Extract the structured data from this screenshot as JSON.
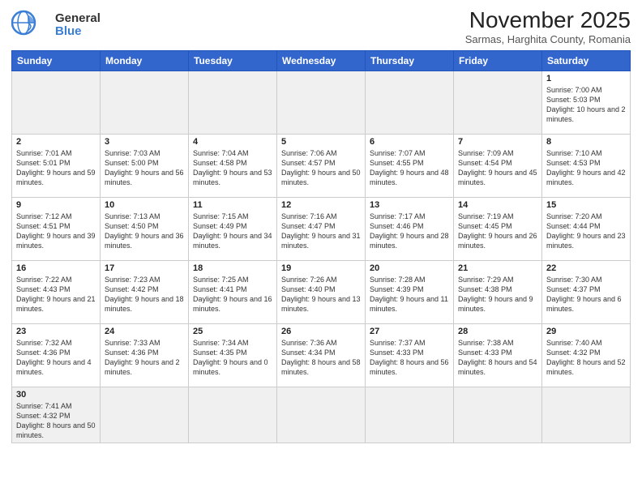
{
  "header": {
    "logo_general": "General",
    "logo_blue": "Blue",
    "month_title": "November 2025",
    "subtitle": "Sarmas, Harghita County, Romania"
  },
  "weekdays": [
    "Sunday",
    "Monday",
    "Tuesday",
    "Wednesday",
    "Thursday",
    "Friday",
    "Saturday"
  ],
  "weeks": [
    [
      {
        "day": "",
        "info": "",
        "empty": true
      },
      {
        "day": "",
        "info": "",
        "empty": true
      },
      {
        "day": "",
        "info": "",
        "empty": true
      },
      {
        "day": "",
        "info": "",
        "empty": true
      },
      {
        "day": "",
        "info": "",
        "empty": true
      },
      {
        "day": "",
        "info": "",
        "empty": true
      },
      {
        "day": "1",
        "info": "Sunrise: 7:00 AM\nSunset: 5:03 PM\nDaylight: 10 hours\nand 2 minutes."
      }
    ],
    [
      {
        "day": "2",
        "info": "Sunrise: 7:01 AM\nSunset: 5:01 PM\nDaylight: 9 hours\nand 59 minutes."
      },
      {
        "day": "3",
        "info": "Sunrise: 7:03 AM\nSunset: 5:00 PM\nDaylight: 9 hours\nand 56 minutes."
      },
      {
        "day": "4",
        "info": "Sunrise: 7:04 AM\nSunset: 4:58 PM\nDaylight: 9 hours\nand 53 minutes."
      },
      {
        "day": "5",
        "info": "Sunrise: 7:06 AM\nSunset: 4:57 PM\nDaylight: 9 hours\nand 50 minutes."
      },
      {
        "day": "6",
        "info": "Sunrise: 7:07 AM\nSunset: 4:55 PM\nDaylight: 9 hours\nand 48 minutes."
      },
      {
        "day": "7",
        "info": "Sunrise: 7:09 AM\nSunset: 4:54 PM\nDaylight: 9 hours\nand 45 minutes."
      },
      {
        "day": "8",
        "info": "Sunrise: 7:10 AM\nSunset: 4:53 PM\nDaylight: 9 hours\nand 42 minutes."
      }
    ],
    [
      {
        "day": "9",
        "info": "Sunrise: 7:12 AM\nSunset: 4:51 PM\nDaylight: 9 hours\nand 39 minutes."
      },
      {
        "day": "10",
        "info": "Sunrise: 7:13 AM\nSunset: 4:50 PM\nDaylight: 9 hours\nand 36 minutes."
      },
      {
        "day": "11",
        "info": "Sunrise: 7:15 AM\nSunset: 4:49 PM\nDaylight: 9 hours\nand 34 minutes."
      },
      {
        "day": "12",
        "info": "Sunrise: 7:16 AM\nSunset: 4:47 PM\nDaylight: 9 hours\nand 31 minutes."
      },
      {
        "day": "13",
        "info": "Sunrise: 7:17 AM\nSunset: 4:46 PM\nDaylight: 9 hours\nand 28 minutes."
      },
      {
        "day": "14",
        "info": "Sunrise: 7:19 AM\nSunset: 4:45 PM\nDaylight: 9 hours\nand 26 minutes."
      },
      {
        "day": "15",
        "info": "Sunrise: 7:20 AM\nSunset: 4:44 PM\nDaylight: 9 hours\nand 23 minutes."
      }
    ],
    [
      {
        "day": "16",
        "info": "Sunrise: 7:22 AM\nSunset: 4:43 PM\nDaylight: 9 hours\nand 21 minutes."
      },
      {
        "day": "17",
        "info": "Sunrise: 7:23 AM\nSunset: 4:42 PM\nDaylight: 9 hours\nand 18 minutes."
      },
      {
        "day": "18",
        "info": "Sunrise: 7:25 AM\nSunset: 4:41 PM\nDaylight: 9 hours\nand 16 minutes."
      },
      {
        "day": "19",
        "info": "Sunrise: 7:26 AM\nSunset: 4:40 PM\nDaylight: 9 hours\nand 13 minutes."
      },
      {
        "day": "20",
        "info": "Sunrise: 7:28 AM\nSunset: 4:39 PM\nDaylight: 9 hours\nand 11 minutes."
      },
      {
        "day": "21",
        "info": "Sunrise: 7:29 AM\nSunset: 4:38 PM\nDaylight: 9 hours\nand 9 minutes."
      },
      {
        "day": "22",
        "info": "Sunrise: 7:30 AM\nSunset: 4:37 PM\nDaylight: 9 hours\nand 6 minutes."
      }
    ],
    [
      {
        "day": "23",
        "info": "Sunrise: 7:32 AM\nSunset: 4:36 PM\nDaylight: 9 hours\nand 4 minutes."
      },
      {
        "day": "24",
        "info": "Sunrise: 7:33 AM\nSunset: 4:36 PM\nDaylight: 9 hours\nand 2 minutes."
      },
      {
        "day": "25",
        "info": "Sunrise: 7:34 AM\nSunset: 4:35 PM\nDaylight: 9 hours\nand 0 minutes."
      },
      {
        "day": "26",
        "info": "Sunrise: 7:36 AM\nSunset: 4:34 PM\nDaylight: 8 hours\nand 58 minutes."
      },
      {
        "day": "27",
        "info": "Sunrise: 7:37 AM\nSunset: 4:33 PM\nDaylight: 8 hours\nand 56 minutes."
      },
      {
        "day": "28",
        "info": "Sunrise: 7:38 AM\nSunset: 4:33 PM\nDaylight: 8 hours\nand 54 minutes."
      },
      {
        "day": "29",
        "info": "Sunrise: 7:40 AM\nSunset: 4:32 PM\nDaylight: 8 hours\nand 52 minutes."
      }
    ],
    [
      {
        "day": "30",
        "info": "Sunrise: 7:41 AM\nSunset: 4:32 PM\nDaylight: 8 hours\nand 50 minutes.",
        "last": true
      },
      {
        "day": "",
        "info": "",
        "empty": true,
        "last": true
      },
      {
        "day": "",
        "info": "",
        "empty": true,
        "last": true
      },
      {
        "day": "",
        "info": "",
        "empty": true,
        "last": true
      },
      {
        "day": "",
        "info": "",
        "empty": true,
        "last": true
      },
      {
        "day": "",
        "info": "",
        "empty": true,
        "last": true
      },
      {
        "day": "",
        "info": "",
        "empty": true,
        "last": true
      }
    ]
  ]
}
